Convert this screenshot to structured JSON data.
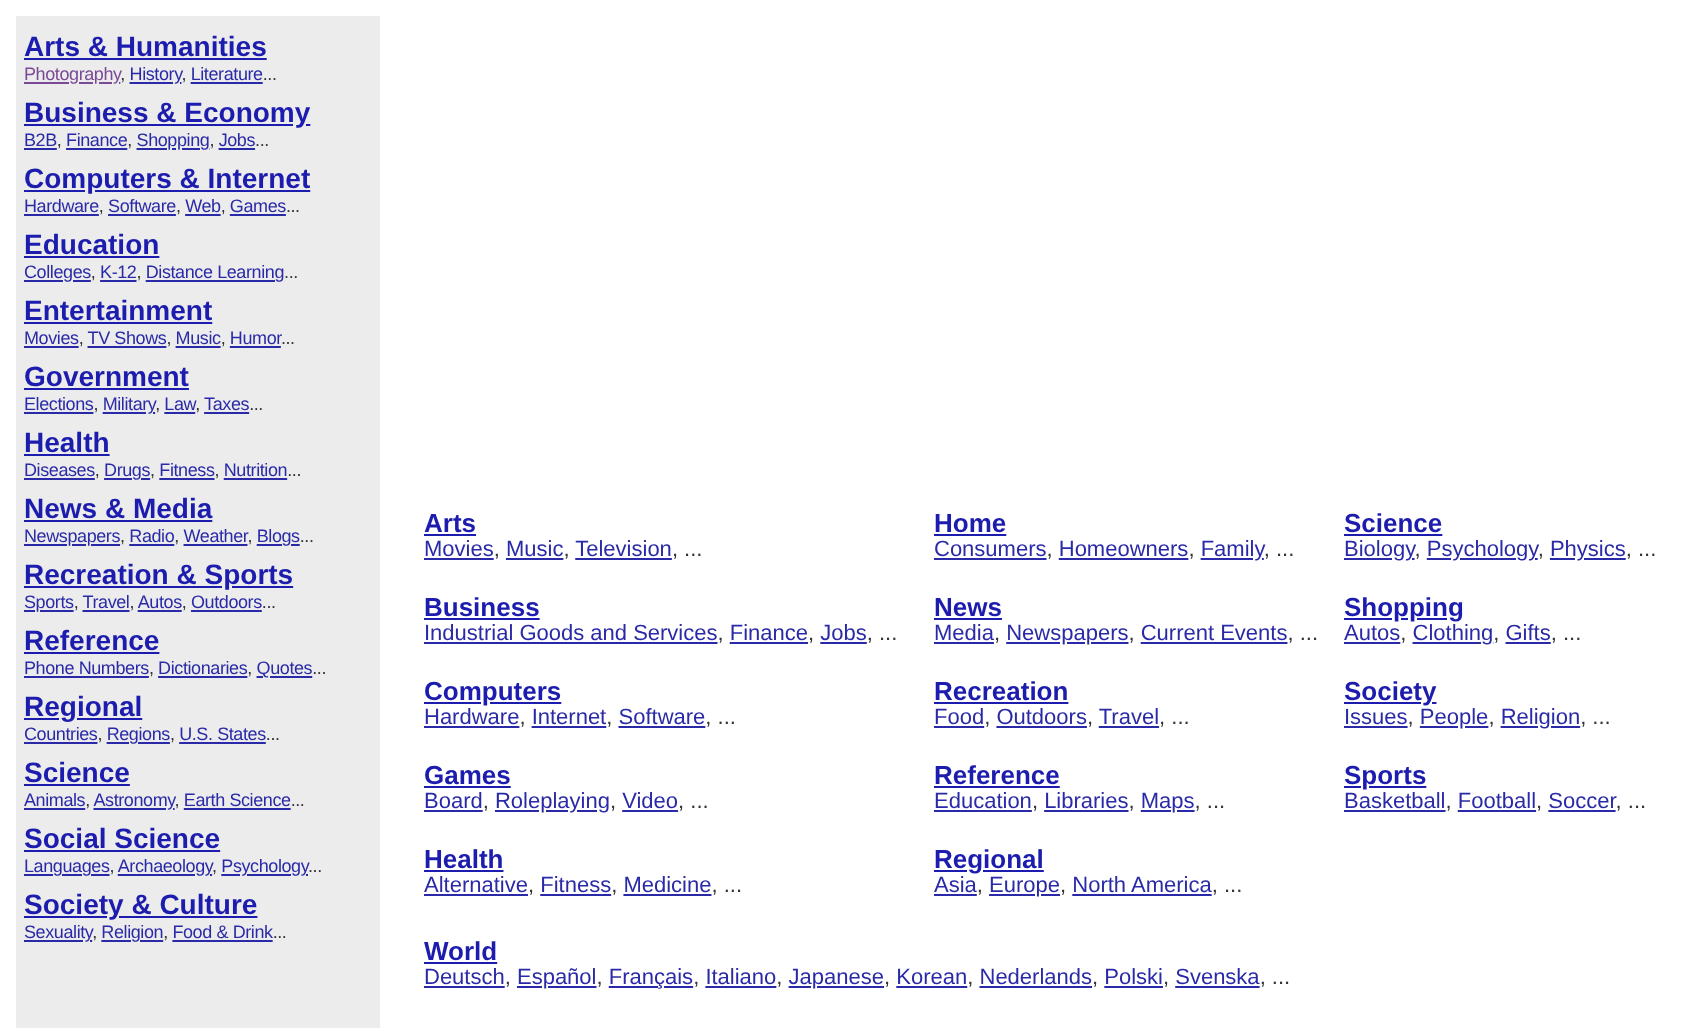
{
  "separator": ",",
  "sidebar": {
    "more": "...",
    "items": [
      {
        "title": "Arts & Humanities",
        "links": [
          {
            "text": "Photography",
            "visited": true
          },
          {
            "text": "History",
            "visited": false
          },
          {
            "text": "Literature",
            "visited": false
          }
        ]
      },
      {
        "title": "Business & Economy",
        "links": [
          {
            "text": "B2B",
            "visited": false
          },
          {
            "text": "Finance",
            "visited": false
          },
          {
            "text": "Shopping",
            "visited": false
          },
          {
            "text": "Jobs",
            "visited": false
          }
        ]
      },
      {
        "title": "Computers & Internet",
        "links": [
          {
            "text": "Hardware",
            "visited": false
          },
          {
            "text": "Software",
            "visited": false
          },
          {
            "text": "Web",
            "visited": false
          },
          {
            "text": "Games",
            "visited": false
          }
        ]
      },
      {
        "title": "Education",
        "links": [
          {
            "text": "Colleges",
            "visited": false
          },
          {
            "text": "K-12",
            "visited": false
          },
          {
            "text": "Distance Learning",
            "visited": false
          }
        ]
      },
      {
        "title": "Entertainment",
        "links": [
          {
            "text": "Movies",
            "visited": false
          },
          {
            "text": "TV Shows",
            "visited": false
          },
          {
            "text": "Music",
            "visited": false
          },
          {
            "text": "Humor",
            "visited": false
          }
        ]
      },
      {
        "title": "Government",
        "links": [
          {
            "text": "Elections",
            "visited": false
          },
          {
            "text": "Military",
            "visited": false
          },
          {
            "text": "Law",
            "visited": false
          },
          {
            "text": "Taxes",
            "visited": false
          }
        ]
      },
      {
        "title": "Health",
        "links": [
          {
            "text": "Diseases",
            "visited": false
          },
          {
            "text": "Drugs",
            "visited": false
          },
          {
            "text": "Fitness",
            "visited": false
          },
          {
            "text": "Nutrition",
            "visited": false
          }
        ]
      },
      {
        "title": "News & Media",
        "links": [
          {
            "text": "Newspapers",
            "visited": false
          },
          {
            "text": "Radio",
            "visited": false
          },
          {
            "text": "Weather",
            "visited": false
          },
          {
            "text": "Blogs",
            "visited": false
          }
        ]
      },
      {
        "title": "Recreation & Sports",
        "links": [
          {
            "text": "Sports",
            "visited": false
          },
          {
            "text": "Travel",
            "visited": false
          },
          {
            "text": "Autos",
            "visited": false
          },
          {
            "text": "Outdoors",
            "visited": false
          }
        ]
      },
      {
        "title": "Reference",
        "links": [
          {
            "text": "Phone Numbers",
            "visited": false
          },
          {
            "text": "Dictionaries",
            "visited": false
          },
          {
            "text": "Quotes",
            "visited": false
          }
        ]
      },
      {
        "title": "Regional",
        "links": [
          {
            "text": "Countries",
            "visited": false
          },
          {
            "text": "Regions",
            "visited": false
          },
          {
            "text": "U.S. States",
            "visited": false
          }
        ]
      },
      {
        "title": "Science",
        "links": [
          {
            "text": "Animals",
            "visited": false
          },
          {
            "text": "Astronomy",
            "visited": false
          },
          {
            "text": "Earth Science",
            "visited": false
          }
        ]
      },
      {
        "title": "Social Science",
        "links": [
          {
            "text": "Languages",
            "visited": false
          },
          {
            "text": "Archaeology",
            "visited": false
          },
          {
            "text": "Psychology",
            "visited": false
          }
        ]
      },
      {
        "title": "Society & Culture",
        "links": [
          {
            "text": "Sexuality",
            "visited": false
          },
          {
            "text": "Religion",
            "visited": false
          },
          {
            "text": "Food & Drink",
            "visited": false
          }
        ]
      }
    ]
  },
  "directory": {
    "more": "...",
    "columns": [
      [
        {
          "title": "Arts",
          "links": [
            "Movies",
            "Music",
            "Television"
          ]
        },
        {
          "title": "Business",
          "links": [
            "Industrial Goods and Services",
            "Finance",
            "Jobs"
          ]
        },
        {
          "title": "Computers",
          "links": [
            "Hardware",
            "Internet",
            "Software"
          ]
        },
        {
          "title": "Games",
          "links": [
            "Board",
            "Roleplaying",
            "Video"
          ]
        },
        {
          "title": "Health",
          "links": [
            "Alternative",
            "Fitness",
            "Medicine"
          ]
        }
      ],
      [
        {
          "title": "Home",
          "links": [
            "Consumers",
            "Homeowners",
            "Family"
          ]
        },
        {
          "title": "News",
          "links": [
            "Media",
            "Newspapers",
            "Current Events"
          ]
        },
        {
          "title": "Recreation",
          "links": [
            "Food",
            "Outdoors",
            "Travel"
          ]
        },
        {
          "title": "Reference",
          "links": [
            "Education",
            "Libraries",
            "Maps"
          ]
        },
        {
          "title": "Regional",
          "links": [
            "Asia",
            "Europe",
            "North America"
          ]
        }
      ],
      [
        {
          "title": "Science",
          "links": [
            "Biology",
            "Psychology",
            "Physics"
          ]
        },
        {
          "title": "Shopping",
          "links": [
            "Autos",
            "Clothing",
            "Gifts"
          ]
        },
        {
          "title": "Society",
          "links": [
            "Issues",
            "People",
            "Religion"
          ]
        },
        {
          "title": "Sports",
          "links": [
            "Basketball",
            "Football",
            "Soccer"
          ]
        }
      ]
    ],
    "world": {
      "title": "World",
      "links": [
        "Deutsch",
        "Español",
        "Français",
        "Italiano",
        "Japanese",
        "Korean",
        "Nederlands",
        "Polski",
        "Svenska"
      ]
    }
  }
}
